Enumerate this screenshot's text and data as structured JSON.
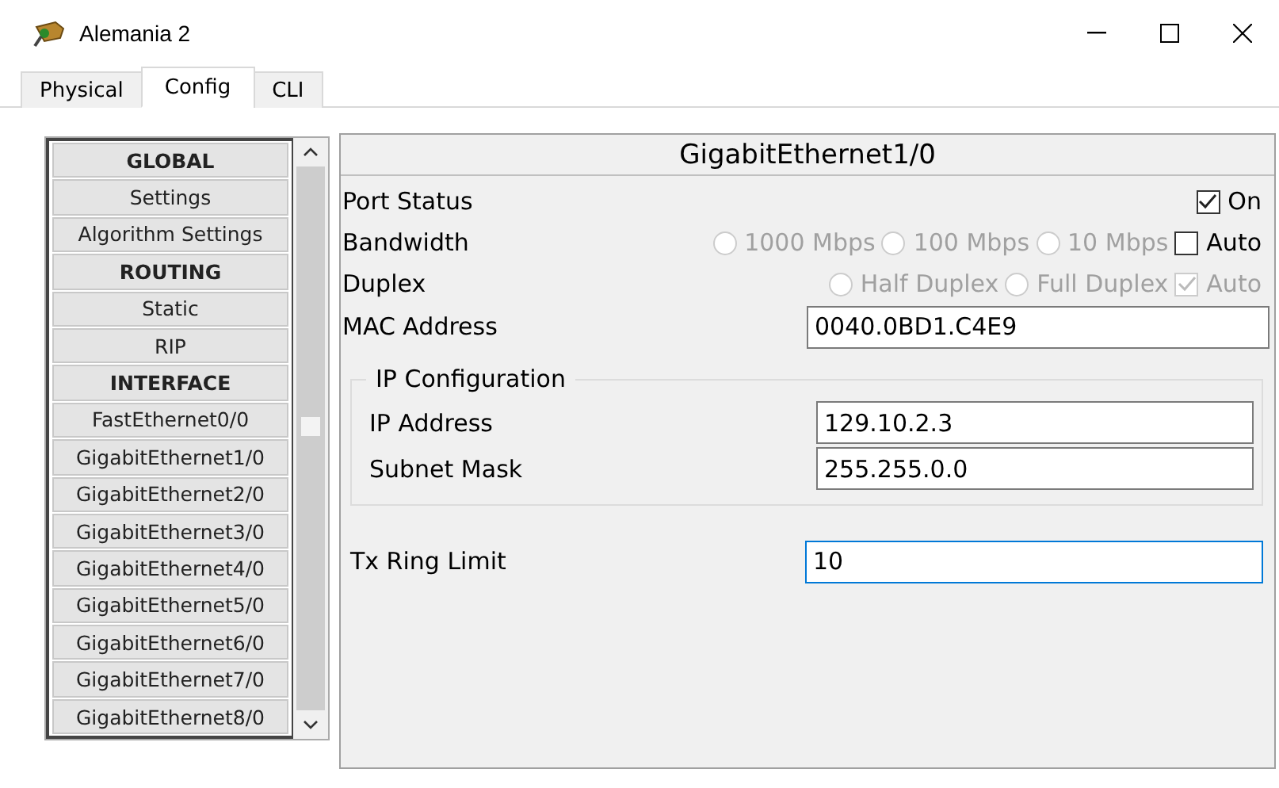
{
  "window": {
    "title": "Alemania 2"
  },
  "tabs": [
    {
      "label": "Physical",
      "selected": false
    },
    {
      "label": "Config",
      "selected": true
    },
    {
      "label": "CLI",
      "selected": false
    }
  ],
  "sidebar": {
    "items": [
      {
        "label": "GLOBAL",
        "kind": "header"
      },
      {
        "label": "Settings",
        "kind": "item"
      },
      {
        "label": "Algorithm Settings",
        "kind": "item"
      },
      {
        "label": "ROUTING",
        "kind": "header"
      },
      {
        "label": "Static",
        "kind": "item"
      },
      {
        "label": "RIP",
        "kind": "item"
      },
      {
        "label": "INTERFACE",
        "kind": "header"
      },
      {
        "label": "FastEthernet0/0",
        "kind": "item"
      },
      {
        "label": "GigabitEthernet1/0",
        "kind": "item"
      },
      {
        "label": "GigabitEthernet2/0",
        "kind": "item"
      },
      {
        "label": "GigabitEthernet3/0",
        "kind": "item"
      },
      {
        "label": "GigabitEthernet4/0",
        "kind": "item"
      },
      {
        "label": "GigabitEthernet5/0",
        "kind": "item"
      },
      {
        "label": "GigabitEthernet6/0",
        "kind": "item"
      },
      {
        "label": "GigabitEthernet7/0",
        "kind": "item"
      },
      {
        "label": "GigabitEthernet8/0",
        "kind": "item"
      }
    ]
  },
  "panel": {
    "title": "GigabitEthernet1/0",
    "settings": [
      {
        "label": "Port Status",
        "options": [
          {
            "kind": "checkbox",
            "label": "On",
            "checked": true,
            "disabled": false
          }
        ]
      },
      {
        "label": "Bandwidth",
        "options": [
          {
            "kind": "radio",
            "label": "1000 Mbps",
            "checked": false,
            "disabled": true
          },
          {
            "kind": "radio",
            "label": "100 Mbps",
            "checked": false,
            "disabled": true
          },
          {
            "kind": "radio",
            "label": "10 Mbps",
            "checked": false,
            "disabled": true
          },
          {
            "kind": "checkbox",
            "label": "Auto",
            "checked": false,
            "disabled": false
          }
        ]
      },
      {
        "label": "Duplex",
        "options": [
          {
            "kind": "radio",
            "label": "Half Duplex",
            "checked": false,
            "disabled": true
          },
          {
            "kind": "radio",
            "label": "Full Duplex",
            "checked": false,
            "disabled": true
          },
          {
            "kind": "checkbox",
            "label": "Auto",
            "checked": true,
            "disabled": true
          }
        ]
      }
    ],
    "mac": {
      "label": "MAC Address",
      "value": "0040.0BD1.C4E9"
    },
    "ip_configuration": {
      "title": "IP Configuration",
      "fields": [
        {
          "label": "IP Address",
          "value": "129.10.2.3"
        },
        {
          "label": "Subnet Mask",
          "value": "255.255.0.0"
        }
      ]
    },
    "tx_ring": {
      "label": "Tx Ring Limit",
      "value": "10",
      "focused": true
    }
  }
}
